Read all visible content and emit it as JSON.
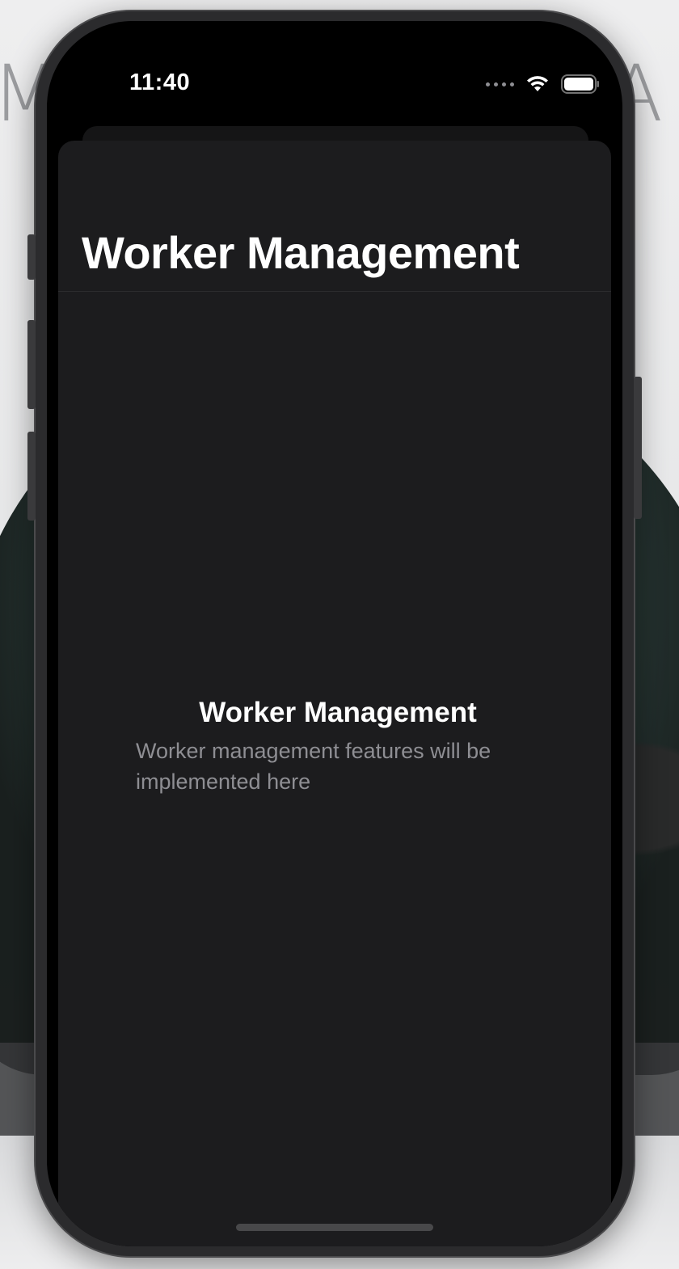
{
  "wallpaper": {
    "letters_left": "ME",
    "letters_right": "CA"
  },
  "status_bar": {
    "time": "11:40",
    "icons": [
      "signal-dots-icon",
      "wifi-icon",
      "battery-icon"
    ]
  },
  "navigation": {
    "title": "Worker Management"
  },
  "empty_state": {
    "title": "Worker Management",
    "description": "Worker management features will be implemented here"
  },
  "colors": {
    "sheet_background": "#1c1c1e",
    "title_text": "#ffffff",
    "secondary_text": "#8e8e93"
  }
}
